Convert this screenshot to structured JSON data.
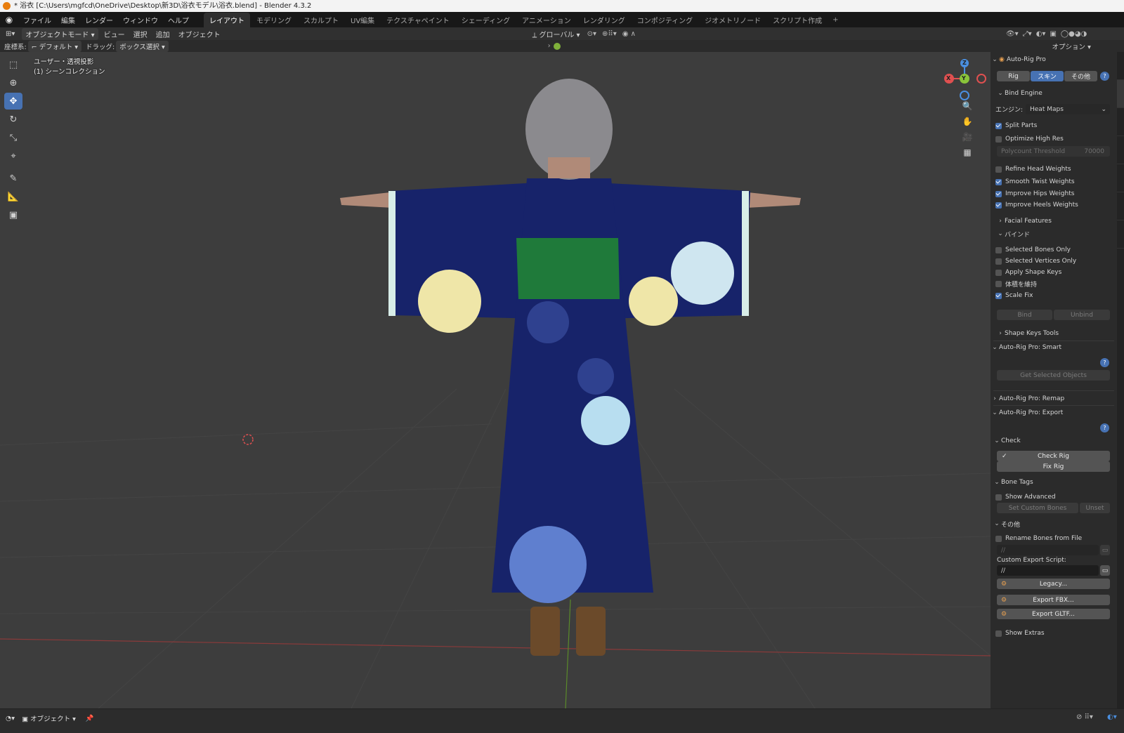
{
  "window": {
    "title": "* 浴衣 [C:\\Users\\mgfcd\\OneDrive\\Desktop\\新3D\\浴衣モデル\\浴衣.blend] - Blender 4.3.2"
  },
  "menu": [
    "ファイル",
    "編集",
    "レンダー",
    "ウィンドウ",
    "ヘルプ"
  ],
  "workspaces": [
    {
      "label": "レイアウト",
      "active": true
    },
    {
      "label": "モデリング"
    },
    {
      "label": "スカルプト"
    },
    {
      "label": "UV編集"
    },
    {
      "label": "テクスチャペイント"
    },
    {
      "label": "シェーディング"
    },
    {
      "label": "アニメーション"
    },
    {
      "label": "レンダリング"
    },
    {
      "label": "コンポジティング"
    },
    {
      "label": "ジオメトリノード"
    },
    {
      "label": "スクリプト作成"
    }
  ],
  "header": {
    "mode": "オブジェクトモード",
    "menus": [
      "ビュー",
      "選択",
      "追加",
      "オブジェクト"
    ],
    "transform_orientation": "グローバル",
    "options": "オプション"
  },
  "header2": {
    "coord_label": "座標系:",
    "coord_value": "デフォルト",
    "drag_label": "ドラッグ:",
    "drag_value": "ボックス選択"
  },
  "viewport": {
    "overlay_line1": "ユーザー・透視投影",
    "overlay_line2": "(1) シーンコレクション",
    "gizmo": {
      "x": "X",
      "y": "Y",
      "z": "Z"
    }
  },
  "panel": {
    "title": "Auto-Rig Pro",
    "tabs": [
      "Rig",
      "スキン",
      "その他"
    ],
    "active_tab": "スキン",
    "bind_engine": "Bind Engine",
    "engine_label": "エンジン:",
    "engine_value": "Heat Maps",
    "split_parts": "Split Parts",
    "optimize_high_res": "Optimize High Res",
    "polycount_label": "Polycount Threshold",
    "polycount_value": "70000",
    "refine_head": "Refine Head Weights",
    "smooth_twist": "Smooth Twist Weights",
    "improve_hips": "Improve Hips Weights",
    "improve_heels": "Improve Heels Weights",
    "facial_features": "Facial Features",
    "bind_section": "バインド",
    "selected_bones_only": "Selected Bones Only",
    "selected_vertices_only": "Selected Vertices Only",
    "apply_shape_keys": "Apply Shape Keys",
    "keep_volume": "体積を維持",
    "scale_fix": "Scale Fix",
    "bind_btn": "Bind",
    "unbind_btn": "Unbind",
    "shape_keys_tools": "Shape Keys Tools",
    "smart_title": "Auto-Rig Pro: Smart",
    "get_selected": "Get Selected Objects",
    "remap_title": "Auto-Rig Pro: Remap",
    "export_title": "Auto-Rig Pro: Export",
    "check_section": "Check",
    "check_rig": "Check Rig",
    "fix_rig": "Fix Rig",
    "bone_tags": "Bone Tags",
    "show_advanced": "Show Advanced",
    "set_custom_bones": "Set Custom Bones",
    "unset": "Unset",
    "other_section": "その他",
    "rename_bones": "Rename Bones from File",
    "path1": "//",
    "custom_export_label": "Custom Export Script:",
    "path2": "//",
    "legacy": "Legacy...",
    "export_fbx": "Export FBX...",
    "export_gltf": "Export GLTF...",
    "show_extras": "Show Extras"
  },
  "checks": {
    "split_parts": true,
    "optimize_high_res": false,
    "refine_head": false,
    "smooth_twist": true,
    "improve_hips": true,
    "improve_heels": true,
    "selected_bones_only": false,
    "selected_vertices_only": false,
    "apply_shape_keys": false,
    "keep_volume": false,
    "scale_fix": true,
    "show_advanced": false,
    "rename_bones": false,
    "show_extras": false
  },
  "footer": {
    "mode": "オブジェクト"
  },
  "colors": {
    "accent": "#4772b3",
    "viewport_bg": "#3d3d3d",
    "panel_bg": "#2b2b2b",
    "kimono": "#17236a"
  }
}
